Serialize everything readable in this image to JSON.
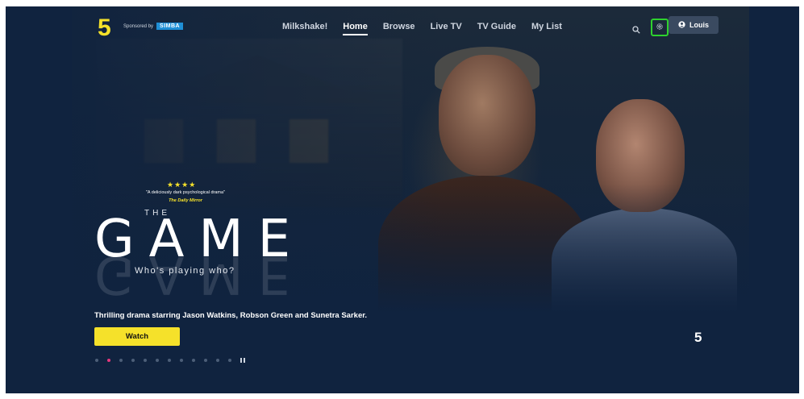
{
  "header": {
    "logo_text": "5",
    "sponsor_text": "Sponsored by",
    "sponsor_brand": "SIMBA",
    "nav": [
      {
        "label": "Milkshake!"
      },
      {
        "label": "Home",
        "active": true
      },
      {
        "label": "Browse"
      },
      {
        "label": "Live TV"
      },
      {
        "label": "TV Guide"
      },
      {
        "label": "My List"
      }
    ],
    "search_icon": "search-icon",
    "settings_icon": "gear-icon",
    "user_icon": "user-icon",
    "user_name": "Louis"
  },
  "hero": {
    "stars": "★★★★",
    "quote": "\"A deliciously dark psychological drama\"",
    "quote_source": "The Daily Mirror",
    "title_prefix": "THE",
    "title": "GAME",
    "tagline": "Who's playing who?",
    "description": "Thrilling drama starring Jason Watkins, Robson Green and Sunetra Sarker.",
    "watch_label": "Watch",
    "channel_badge": "5"
  },
  "carousel": {
    "active_index": 1,
    "dot_count": 12,
    "pause_icon": "pause-icon"
  },
  "colors": {
    "background": "#10233f",
    "accent_yellow": "#f5e12a",
    "active_dot": "#e6387d",
    "focus_outline": "#2ed22e"
  }
}
